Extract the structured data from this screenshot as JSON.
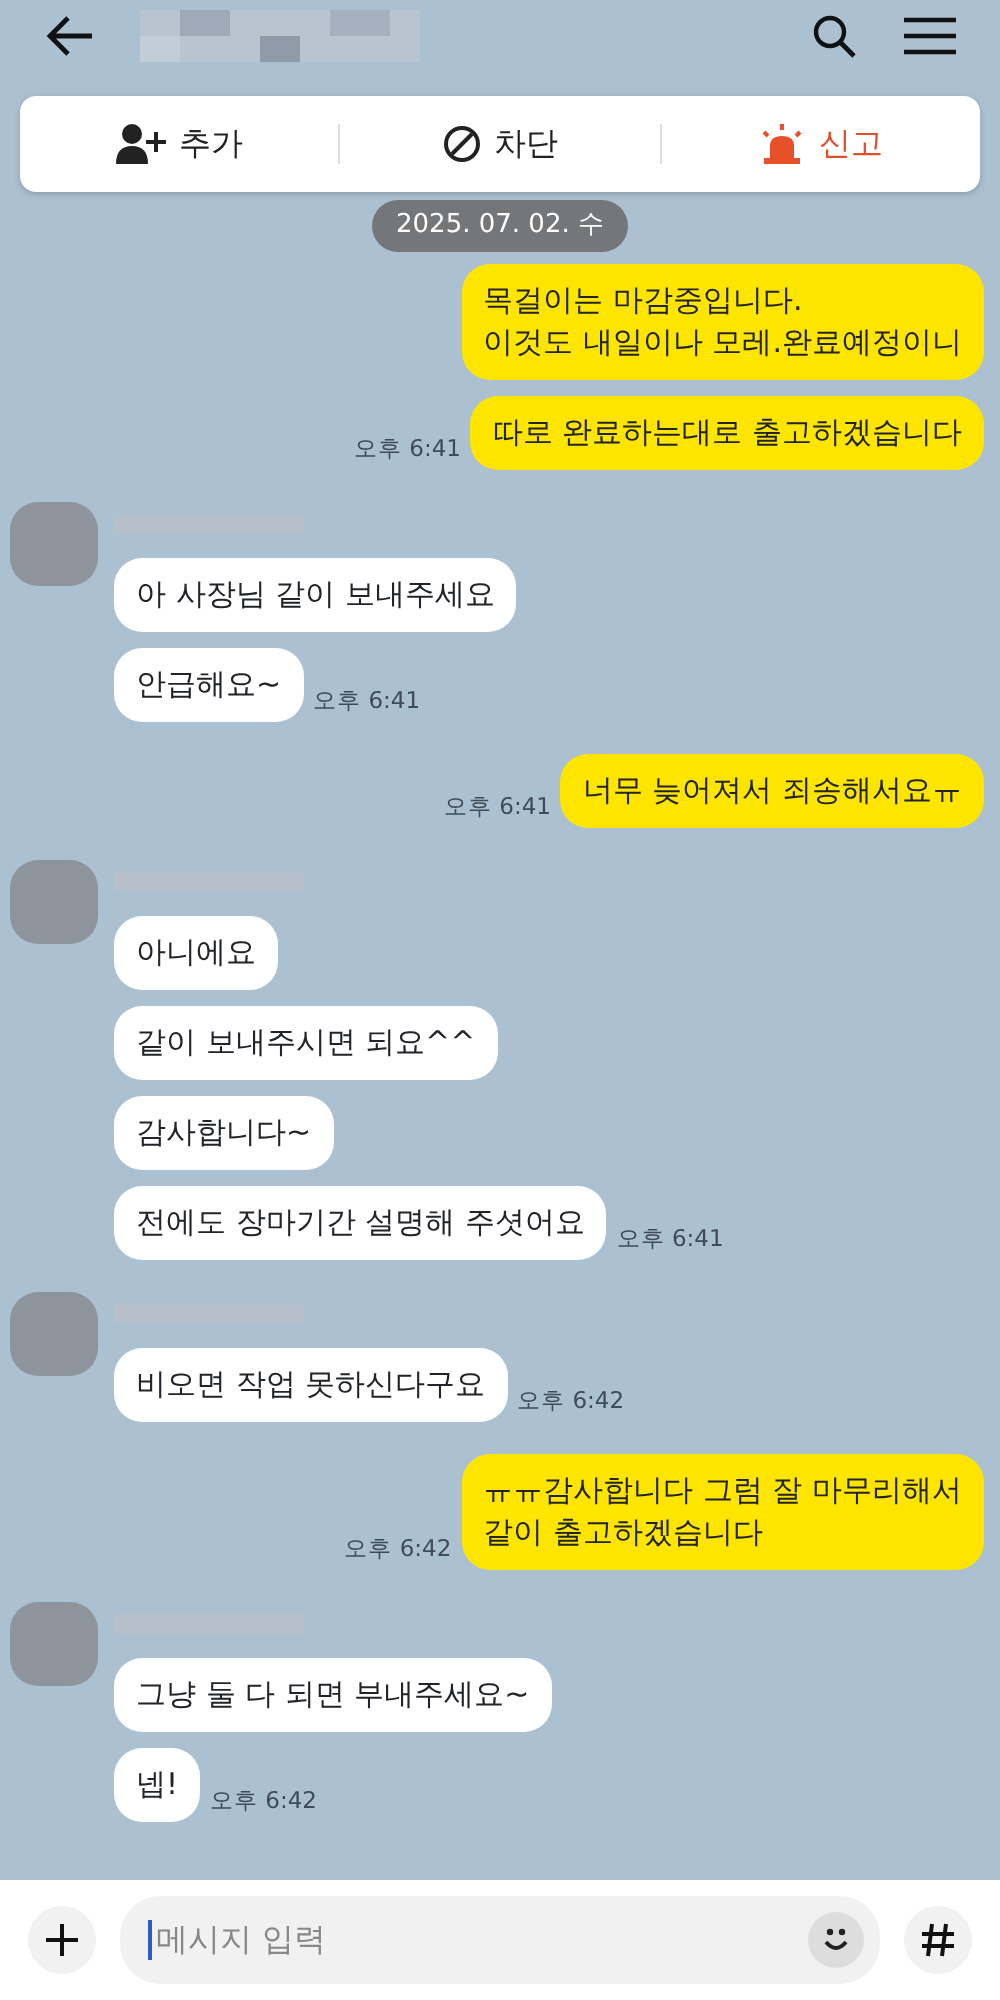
{
  "actions": [
    {
      "kind": "add",
      "label": "추가"
    },
    {
      "kind": "block",
      "label": "차단"
    },
    {
      "kind": "report",
      "label": "신고"
    }
  ],
  "date_badge": "2025. 07. 02. 수",
  "groups": [
    {
      "kind": "sent",
      "messages": [
        {
          "lines": [
            "목걸이는 마감중입니다.",
            "이것도 내일이나 모레.완료예정이니"
          ]
        },
        {
          "lines": [
            "따로 완료하는대로 출고하겠습니다"
          ],
          "time": "오후 6:41"
        }
      ]
    },
    {
      "kind": "received",
      "messages": [
        {
          "lines": [
            "아 사장님 같이 보내주세요"
          ]
        },
        {
          "lines": [
            "안급해요~"
          ],
          "time": "오후 6:41"
        }
      ]
    },
    {
      "kind": "sent",
      "messages": [
        {
          "lines": [
            "너무 늦어져서 죄송해서요ㅠ"
          ],
          "time": "오후 6:41"
        }
      ]
    },
    {
      "kind": "received",
      "messages": [
        {
          "lines": [
            "아니에요"
          ]
        },
        {
          "lines": [
            "같이 보내주시면 되요^^"
          ]
        },
        {
          "lines": [
            "감사합니다~"
          ]
        },
        {
          "lines": [
            "전에도 장마기간 설명해 주셧어요"
          ],
          "time": "오후 6:41"
        }
      ]
    },
    {
      "kind": "received",
      "messages": [
        {
          "lines": [
            "비오면 작업 못하신다구요"
          ],
          "time": "오후 6:42"
        }
      ]
    },
    {
      "kind": "sent",
      "messages": [
        {
          "lines": [
            "ㅠㅠ감사합니다 그럼 잘 마무리해서",
            "같이 출고하겠습니다"
          ],
          "time": "오후 6:42"
        }
      ]
    },
    {
      "kind": "received",
      "messages": [
        {
          "lines": [
            "그냥 둘 다 되면 부내주세요~"
          ]
        },
        {
          "lines": [
            "넵!"
          ],
          "time": "오후 6:42"
        }
      ]
    }
  ],
  "input": {
    "placeholder": "메시지 입력"
  }
}
